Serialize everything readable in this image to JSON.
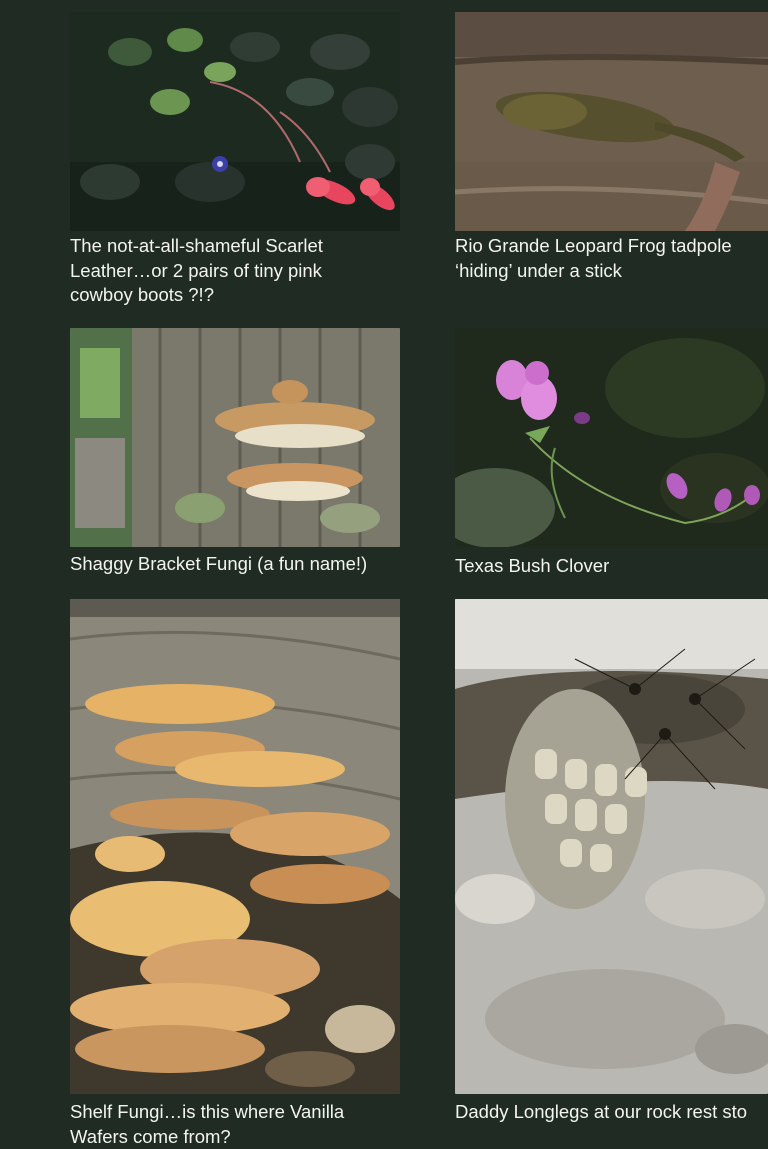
{
  "gallery": [
    {
      "image_alt": "Scarlet Leatherflower blossoms",
      "caption_lines": [
        "The not-at-all-shameful Scarlet",
        "Leather…or 2 pairs of tiny pink",
        "cowboy boots ?!?"
      ]
    },
    {
      "image_alt": "Rio Grande Leopard Frog tadpole under a stick",
      "caption_lines": [
        "Rio Grande Leopard Frog tadpole",
        "‘hiding’ under a stick"
      ]
    },
    {
      "image_alt": "Shaggy Bracket Fungi on a tree trunk",
      "caption_lines": [
        "Shaggy Bracket Fungi (a fun name!)"
      ]
    },
    {
      "image_alt": "Texas Bush Clover flowers",
      "caption_lines": [
        "Texas Bush Clover"
      ]
    },
    {
      "image_alt": "Shelf Fungi on a log",
      "caption_lines": [
        "Shelf Fungi…is this where Vanilla",
        "Wafers come from?"
      ]
    },
    {
      "image_alt": "Daddy Longlegs on a rock",
      "caption_lines": [
        "Daddy Longlegs at our rock rest sto"
      ]
    }
  ]
}
